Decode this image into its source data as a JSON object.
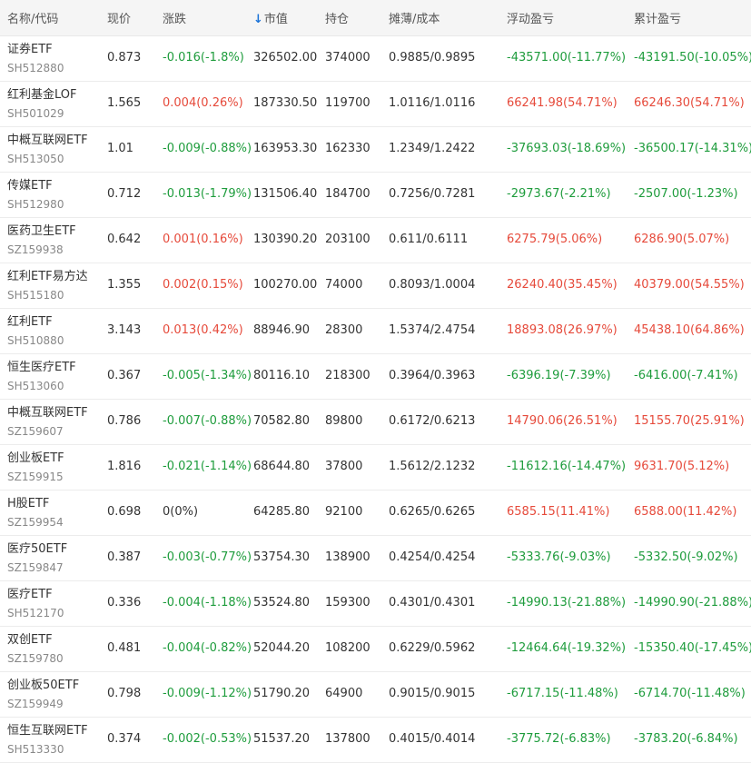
{
  "header": {
    "name_code": "名称/代码",
    "price": "现价",
    "change": "涨跌",
    "market_value": "市值",
    "sort_arrow": "↓",
    "holding": "持仓",
    "cost": "摊薄/成本",
    "float_pl": "浮动盈亏",
    "total_pl": "累计盈亏"
  },
  "colors": {
    "up": "#e64a3b",
    "down": "#1e9c3c",
    "flat": "#333333",
    "sort_accent": "#1a73d8"
  },
  "rows": [
    {
      "name": "证券ETF",
      "code": "SH512880",
      "price": "0.873",
      "change": "-0.016(-1.8%)",
      "change_dir": "down",
      "market_value": "326502.00",
      "holding": "374000",
      "cost": "0.9885/0.9895",
      "float_pl": "-43571.00(-11.77%)",
      "float_dir": "down",
      "total_pl": "-43191.50(-10.05%)",
      "total_dir": "down"
    },
    {
      "name": "红利基金LOF",
      "code": "SH501029",
      "price": "1.565",
      "change": "0.004(0.26%)",
      "change_dir": "up",
      "market_value": "187330.50",
      "holding": "119700",
      "cost": "1.0116/1.0116",
      "float_pl": "66241.98(54.71%)",
      "float_dir": "up",
      "total_pl": "66246.30(54.71%)",
      "total_dir": "up"
    },
    {
      "name": "中概互联网ETF",
      "code": "SH513050",
      "price": "1.01",
      "change": "-0.009(-0.88%)",
      "change_dir": "down",
      "market_value": "163953.30",
      "holding": "162330",
      "cost": "1.2349/1.2422",
      "float_pl": "-37693.03(-18.69%)",
      "float_dir": "down",
      "total_pl": "-36500.17(-14.31%)",
      "total_dir": "down"
    },
    {
      "name": "传媒ETF",
      "code": "SH512980",
      "price": "0.712",
      "change": "-0.013(-1.79%)",
      "change_dir": "down",
      "market_value": "131506.40",
      "holding": "184700",
      "cost": "0.7256/0.7281",
      "float_pl": "-2973.67(-2.21%)",
      "float_dir": "down",
      "total_pl": "-2507.00(-1.23%)",
      "total_dir": "down"
    },
    {
      "name": "医药卫生ETF",
      "code": "SZ159938",
      "price": "0.642",
      "change": "0.001(0.16%)",
      "change_dir": "up",
      "market_value": "130390.20",
      "holding": "203100",
      "cost": "0.611/0.6111",
      "float_pl": "6275.79(5.06%)",
      "float_dir": "up",
      "total_pl": "6286.90(5.07%)",
      "total_dir": "up"
    },
    {
      "name": "红利ETF易方达",
      "code": "SH515180",
      "price": "1.355",
      "change": "0.002(0.15%)",
      "change_dir": "up",
      "market_value": "100270.00",
      "holding": "74000",
      "cost": "0.8093/1.0004",
      "float_pl": "26240.40(35.45%)",
      "float_dir": "up",
      "total_pl": "40379.00(54.55%)",
      "total_dir": "up"
    },
    {
      "name": "红利ETF",
      "code": "SH510880",
      "price": "3.143",
      "change": "0.013(0.42%)",
      "change_dir": "up",
      "market_value": "88946.90",
      "holding": "28300",
      "cost": "1.5374/2.4754",
      "float_pl": "18893.08(26.97%)",
      "float_dir": "up",
      "total_pl": "45438.10(64.86%)",
      "total_dir": "up"
    },
    {
      "name": "恒生医疗ETF",
      "code": "SH513060",
      "price": "0.367",
      "change": "-0.005(-1.34%)",
      "change_dir": "down",
      "market_value": "80116.10",
      "holding": "218300",
      "cost": "0.3964/0.3963",
      "float_pl": "-6396.19(-7.39%)",
      "float_dir": "down",
      "total_pl": "-6416.00(-7.41%)",
      "total_dir": "down"
    },
    {
      "name": "中概互联网ETF",
      "code": "SZ159607",
      "price": "0.786",
      "change": "-0.007(-0.88%)",
      "change_dir": "down",
      "market_value": "70582.80",
      "holding": "89800",
      "cost": "0.6172/0.6213",
      "float_pl": "14790.06(26.51%)",
      "float_dir": "up",
      "total_pl": "15155.70(25.91%)",
      "total_dir": "up"
    },
    {
      "name": "创业板ETF",
      "code": "SZ159915",
      "price": "1.816",
      "change": "-0.021(-1.14%)",
      "change_dir": "down",
      "market_value": "68644.80",
      "holding": "37800",
      "cost": "1.5612/2.1232",
      "float_pl": "-11612.16(-14.47%)",
      "float_dir": "down",
      "total_pl": "9631.70(5.12%)",
      "total_dir": "up"
    },
    {
      "name": "H股ETF",
      "code": "SZ159954",
      "price": "0.698",
      "change": "0(0%)",
      "change_dir": "flat",
      "market_value": "64285.80",
      "holding": "92100",
      "cost": "0.6265/0.6265",
      "float_pl": "6585.15(11.41%)",
      "float_dir": "up",
      "total_pl": "6588.00(11.42%)",
      "total_dir": "up"
    },
    {
      "name": "医疗50ETF",
      "code": "SZ159847",
      "price": "0.387",
      "change": "-0.003(-0.77%)",
      "change_dir": "down",
      "market_value": "53754.30",
      "holding": "138900",
      "cost": "0.4254/0.4254",
      "float_pl": "-5333.76(-9.03%)",
      "float_dir": "down",
      "total_pl": "-5332.50(-9.02%)",
      "total_dir": "down"
    },
    {
      "name": "医疗ETF",
      "code": "SH512170",
      "price": "0.336",
      "change": "-0.004(-1.18%)",
      "change_dir": "down",
      "market_value": "53524.80",
      "holding": "159300",
      "cost": "0.4301/0.4301",
      "float_pl": "-14990.13(-21.88%)",
      "float_dir": "down",
      "total_pl": "-14990.90(-21.88%)",
      "total_dir": "down"
    },
    {
      "name": "双创ETF",
      "code": "SZ159780",
      "price": "0.481",
      "change": "-0.004(-0.82%)",
      "change_dir": "down",
      "market_value": "52044.20",
      "holding": "108200",
      "cost": "0.6229/0.5962",
      "float_pl": "-12464.64(-19.32%)",
      "float_dir": "down",
      "total_pl": "-15350.40(-17.45%)",
      "total_dir": "down"
    },
    {
      "name": "创业板50ETF",
      "code": "SZ159949",
      "price": "0.798",
      "change": "-0.009(-1.12%)",
      "change_dir": "down",
      "market_value": "51790.20",
      "holding": "64900",
      "cost": "0.9015/0.9015",
      "float_pl": "-6717.15(-11.48%)",
      "float_dir": "down",
      "total_pl": "-6714.70(-11.48%)",
      "total_dir": "down"
    },
    {
      "name": "恒生互联网ETF",
      "code": "SH513330",
      "price": "0.374",
      "change": "-0.002(-0.53%)",
      "change_dir": "down",
      "market_value": "51537.20",
      "holding": "137800",
      "cost": "0.4015/0.4014",
      "float_pl": "-3775.72(-6.83%)",
      "float_dir": "down",
      "total_pl": "-3783.20(-6.84%)",
      "total_dir": "down"
    }
  ]
}
